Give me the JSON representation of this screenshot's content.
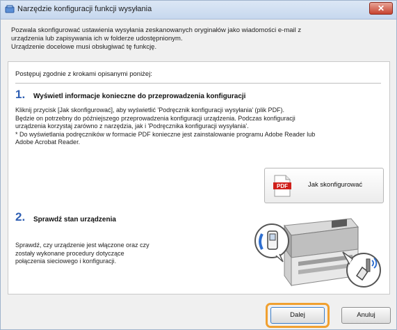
{
  "window": {
    "title": "Narzędzie konfiguracji funkcji wysyłania"
  },
  "intro": {
    "lines": [
      "Pozwala skonfigurować ustawienia wysyłania zeskanowanych oryginałów jako wiadomości e-mail z",
      "urządzenia lub zapisywania ich w folderze udostępnionym.",
      "Urządzenie docelowe musi obsługiwać tę funkcję."
    ]
  },
  "panel": {
    "instruction": "Postępuj zgodnie z krokami opisanymi poniżej:",
    "step1": {
      "number": "1.",
      "title": "Wyświetl informacje konieczne do przeprowadzenia konfiguracji",
      "lines": [
        "Kliknij przycisk [Jak skonfigurować], aby wyświetlić 'Podręcznik konfiguracji wysyłania' (plik PDF).",
        "Będzie on potrzebny do późniejszego przeprowadzenia konfiguracji urządzenia. Podczas konfiguracji",
        "urządzenia korzystaj zarówno z narzędzia, jak i 'Podręcznika konfiguracji wysyłania'.",
        "* Do wyświetlania podręczników w formacie PDF konieczne jest zainstalowanie programu Adobe Reader lub",
        "Adobe Acrobat Reader."
      ],
      "button_label": "Jak skonfigurować",
      "pdf_icon_text": "PDF"
    },
    "step2": {
      "number": "2.",
      "title": "Sprawdź stan urządzenia",
      "lines": [
        "Sprawdź, czy urządzenie jest włączone oraz czy",
        "zostały wykonane procedury dotyczące",
        "połączenia sieciowego i konfiguracji."
      ]
    }
  },
  "footer": {
    "next_label": "Dalej",
    "cancel_label": "Anuluj"
  },
  "colors": {
    "step_number": "#2f5fb3",
    "focus_ring": "#f0a030",
    "close_button": "#c7432f"
  }
}
